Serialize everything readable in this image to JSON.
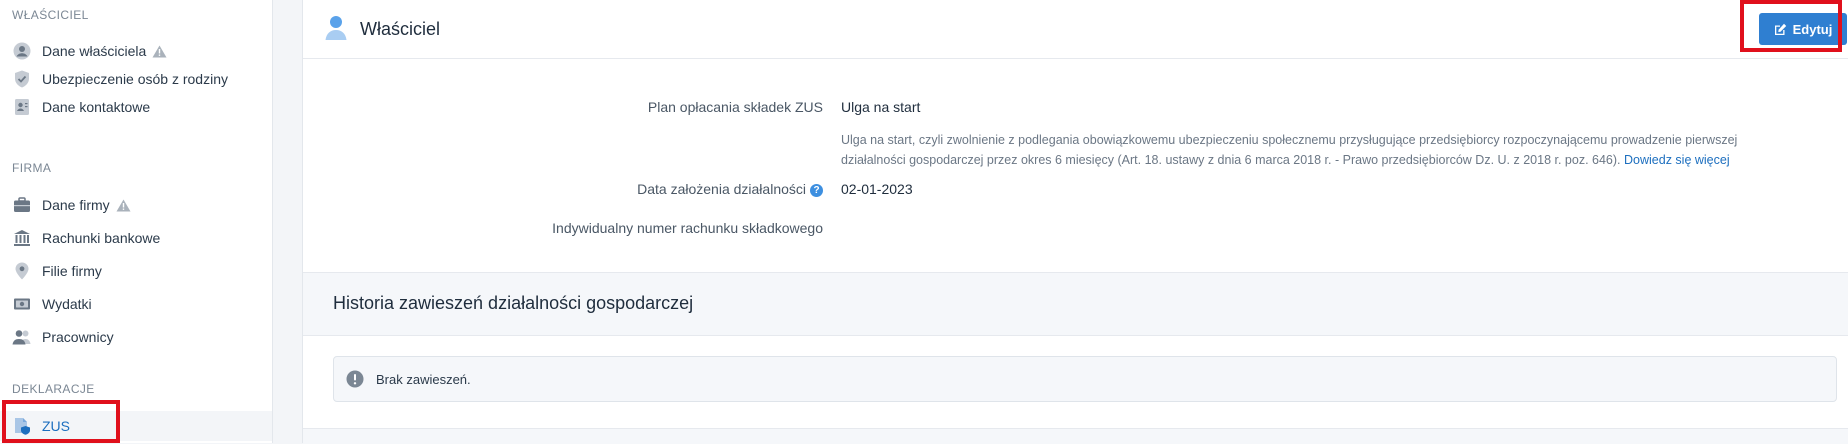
{
  "sidebar": {
    "sections": [
      {
        "label": "WŁAŚCICIEL"
      },
      {
        "label": "FIRMA"
      },
      {
        "label": "DEKLARACJE"
      }
    ],
    "items": [
      {
        "label": "Dane właściciela"
      },
      {
        "label": "Ubezpieczenie osób z rodziny"
      },
      {
        "label": "Dane kontaktowe"
      },
      {
        "label": "Dane firmy"
      },
      {
        "label": "Rachunki bankowe"
      },
      {
        "label": "Filie firmy"
      },
      {
        "label": "Wydatki"
      },
      {
        "label": "Pracownicy"
      },
      {
        "label": "ZUS"
      }
    ]
  },
  "panel": {
    "title": "Właściciel",
    "edit_label": "Edytuj",
    "fields": [
      {
        "label": "Plan opłacania składek ZUS",
        "value": "Ulga na start"
      },
      {
        "label": "Data założenia działalności",
        "value": "02-01-2023"
      },
      {
        "label": "Indywidualny numer rachunku składkowego",
        "value": ""
      }
    ],
    "description": "Ulga na start, czyli zwolnienie z podlegania obowiązkowemu ubezpieczeniu społecznemu przysługujące przedsiębiorcy rozpoczynającemu prowadzenie pierwszej działalności gospodarczej przez okres 6 miesięcy (Art. 18. ustawy z dnia 6 marca 2018 r. - Prawo przedsiębiorców Dz. U. z 2018 r. poz. 646).",
    "learn_more": "Dowiedz się więcej",
    "help_glyph": "?"
  },
  "history": {
    "title": "Historia zawieszeń działalności gospodarczej",
    "empty_text": "Brak zawieszeń."
  },
  "colors": {
    "accent": "#2f7fd1",
    "highlight": "#e0101c",
    "warning_icon": "#9aa3ad"
  }
}
